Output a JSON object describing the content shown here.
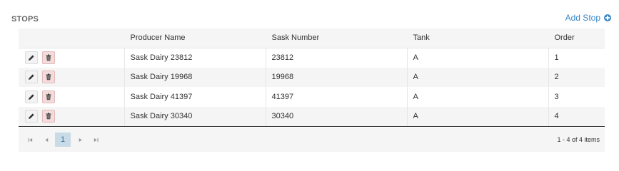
{
  "section": {
    "title": "STOPS",
    "add_label": "Add Stop"
  },
  "table": {
    "columns": [
      "",
      "Producer Name",
      "Sask Number",
      "Tank",
      "Order"
    ],
    "rows": [
      {
        "producer": "Sask Dairy 23812",
        "sask_number": "23812",
        "tank": "A",
        "order": "1"
      },
      {
        "producer": "Sask Dairy 19968",
        "sask_number": "19968",
        "tank": "A",
        "order": "2"
      },
      {
        "producer": "Sask Dairy 41397",
        "sask_number": "41397",
        "tank": "A",
        "order": "3"
      },
      {
        "producer": "Sask Dairy 30340",
        "sask_number": "30340",
        "tank": "A",
        "order": "4"
      }
    ],
    "row_actions": [
      "pencil-icon",
      "trash-icon"
    ]
  },
  "pager": {
    "current_page": "1",
    "info": "1 - 4 of 4 items",
    "controls": [
      "first-page-icon",
      "previous-page-icon",
      "next-page-icon",
      "last-page-icon"
    ]
  },
  "colors": {
    "accent": "#3a87c8",
    "delete": "#f4dcdc",
    "page_active": "#c9dbe6"
  }
}
